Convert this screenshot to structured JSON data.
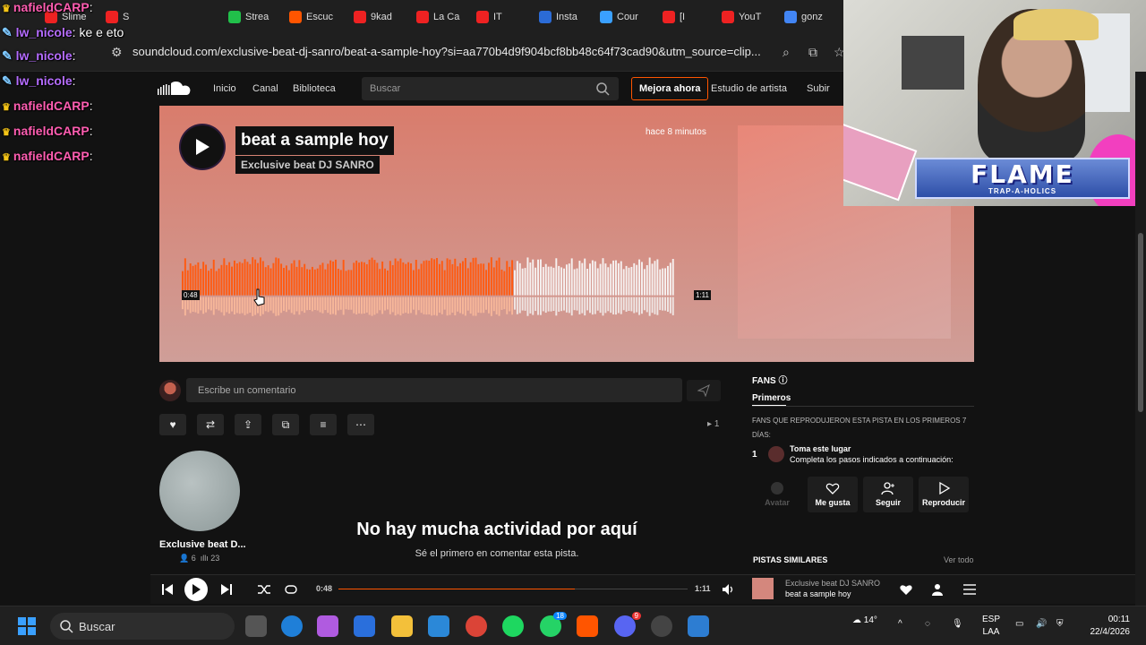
{
  "tabs": [
    {
      "label": "Slime",
      "color": "#e22"
    },
    {
      "label": "S",
      "color": "#e22"
    },
    {
      "label": "Strea",
      "color": "#21c04a"
    },
    {
      "label": "Escuc",
      "color": "#ff5500"
    },
    {
      "label": "9kad",
      "color": "#e22"
    },
    {
      "label": "La Ca",
      "color": "#e22"
    },
    {
      "label": "IT",
      "color": "#e22"
    },
    {
      "label": "Insta",
      "color": "#2b6bd6"
    },
    {
      "label": "Cour",
      "color": "#3aa0ff"
    },
    {
      "label": "[I",
      "color": "#e22"
    },
    {
      "label": "YouT",
      "color": "#e22"
    },
    {
      "label": "gonz",
      "color": "#4285f4"
    }
  ],
  "address": {
    "url": "soundcloud.com/exclusive-beat-dj-sanro/beat-a-sample-hoy?si=aa770b4d9f904bcf8bb48c64f73cad90&utm_source=clip..."
  },
  "chat": [
    {
      "user": "nafieldCARP",
      "msg": "",
      "kind": "carp"
    },
    {
      "user": "lw_nicole",
      "msg": "ke e eto",
      "kind": "nicole"
    },
    {
      "user": "lw_nicole",
      "msg": "",
      "kind": "nicole"
    },
    {
      "user": "lw_nicole",
      "msg": "",
      "kind": "nicole"
    },
    {
      "user": "nafieldCARP",
      "msg": "",
      "kind": "carp"
    },
    {
      "user": "nafieldCARP",
      "msg": "",
      "kind": "carp"
    },
    {
      "user": "nafieldCARP",
      "msg": "",
      "kind": "carp"
    }
  ],
  "header": {
    "nav_home": "Inicio",
    "nav_feed": "Canal",
    "nav_library": "Biblioteca",
    "search_placeholder": "Buscar",
    "upgrade": "Mejora ahora",
    "artist_studio": "Estudio de artista",
    "upload": "Subir"
  },
  "track": {
    "title": "beat a sample hoy",
    "artist": "Exclusive beat DJ SANRO",
    "posted": "hace 8 minutos",
    "current_time": "0:48",
    "duration": "1:11",
    "progress": 0.676,
    "plays": "1"
  },
  "comment": {
    "placeholder": "Escribe un comentario"
  },
  "artist": {
    "name": "Exclusive beat D...",
    "followers": "6",
    "tracks": "23"
  },
  "empty": {
    "title": "No hay mucha actividad por aquí",
    "subtitle": "Sé el primero en comentar esta pista."
  },
  "fans": {
    "heading": "FANS",
    "tab": "Primeros",
    "desc": "FANS QUE REPRODUJERON ESTA PISTA EN LOS PRIMEROS 7 DÍAS:",
    "rank": "1",
    "slot_name": "Toma este lugar",
    "slot_hint": "Completa los pasos indicados a continuación:",
    "btn_avatar": "Avatar",
    "btn_like": "Me gusta",
    "btn_follow": "Seguir",
    "btn_play": "Reproducir"
  },
  "similar": {
    "heading": "PISTAS SIMILARES",
    "view_all": "Ver todo"
  },
  "player": {
    "current": "0:48",
    "total": "1:11",
    "progress": 0.676,
    "artist": "Exclusive beat DJ SANRO",
    "title": "beat a sample hoy"
  },
  "overlay": {
    "flame_title": "FLAME",
    "flame_sub": "TRAP-A-HOLICS"
  },
  "taskbar": {
    "search": "Buscar",
    "temp": "14°",
    "lang1": "ESP",
    "lang2": "LAA",
    "time": "00:11",
    "date": "22/4/2026",
    "whatsapp_badge": "18",
    "discord_badge": "9"
  },
  "colors": {
    "accent": "#ff5500",
    "background": "#121212"
  }
}
